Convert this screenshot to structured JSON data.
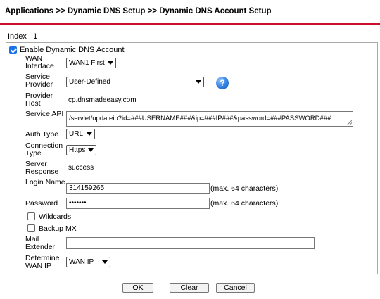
{
  "breadcrumb": "Applications >> Dynamic DNS Setup >> Dynamic DNS Account Setup",
  "index_label": "Index : 1",
  "enable": {
    "label": "Enable Dynamic DNS Account",
    "checked": true
  },
  "form": {
    "wan_interface": {
      "label": "WAN Interface",
      "value": "WAN1 First"
    },
    "service_provider": {
      "label": "Service Provider",
      "value": "User-Defined",
      "help_icon": "help-icon"
    },
    "provider_host": {
      "label": "Provider Host",
      "value": "cp.dnsmadeeasy.com"
    },
    "service_api": {
      "label": "Service API",
      "value": "/servlet/updateip?id=###USERNAME###&ip=###IP###&password=###PASSWORD###"
    },
    "auth_type": {
      "label": "Auth Type",
      "value": "URL"
    },
    "connection_type": {
      "label": "Connection Type",
      "value": "Https"
    },
    "server_response": {
      "label": "Server Response",
      "value": "success"
    },
    "login_name": {
      "label": "Login Name",
      "value": "314159265",
      "hint": "(max. 64 characters)"
    },
    "password": {
      "label": "Password",
      "value": "•••••••",
      "hint": "(max. 64 characters)"
    },
    "wildcards": {
      "label": "Wildcards",
      "checked": false
    },
    "backup_mx": {
      "label": "Backup MX",
      "checked": false
    },
    "mail_extender": {
      "label": "Mail Extender",
      "value": ""
    },
    "determine_wan_ip": {
      "label": "Determine WAN IP",
      "value": "WAN IP"
    }
  },
  "buttons": {
    "ok": "OK",
    "clear": "Clear",
    "cancel": "Cancel"
  },
  "colors": {
    "accent_rule": "#c8102e",
    "checkbox": "#1a73e8"
  }
}
